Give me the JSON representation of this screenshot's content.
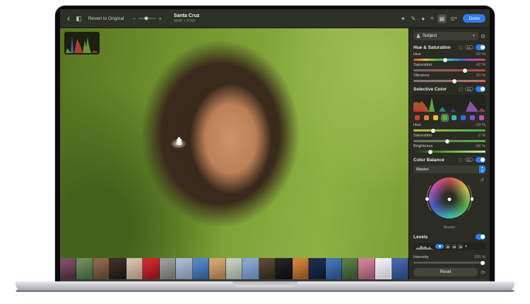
{
  "toolbar": {
    "back": "‹",
    "revert_label": "Revert to Original",
    "zoom_out": "−",
    "zoom_in": "+",
    "title": "Santa Cruz",
    "subtitle": "8640 × 5760",
    "done_label": "Done"
  },
  "sidebar": {
    "preset_label": "Subject",
    "hue_saturation": {
      "title": "Hue & Saturation",
      "ml": "ML",
      "sliders": [
        {
          "label": "Hue",
          "value": "-10 %",
          "pos": "44%"
        },
        {
          "label": "Saturation",
          "value": "42 %",
          "pos": "72%"
        },
        {
          "label": "Vibrance",
          "value": "20 %",
          "pos": "57%"
        }
      ]
    },
    "selective_color": {
      "title": "Selective Color",
      "ml": "ML",
      "swatches": [
        "#d23f33",
        "#e07f2e",
        "#e6c02e",
        "#4fb43a",
        "#35b8ae",
        "#3a6ae0",
        "#7f4fd0",
        "#c04fae"
      ],
      "selected_swatch_index": 3,
      "sliders": [
        {
          "label": "Hue",
          "value": "-18 %",
          "pos": "27%"
        },
        {
          "label": "Saturation",
          "value": "-3 %",
          "pos": "47%"
        },
        {
          "label": "Brightness",
          "value": "-46 %",
          "pos": "24%"
        }
      ]
    },
    "color_balance": {
      "title": "Color Balance",
      "ml": "ML",
      "range_label": "Master",
      "wheel_label": "Master"
    },
    "levels": {
      "title": "Levels"
    },
    "intensity": {
      "label": "Intensity",
      "value": "100 %",
      "pos": "96%"
    },
    "reset_label": "Reset"
  },
  "filmstrip": {
    "selected_index": 19,
    "thumbs": [
      {
        "c1": "#7a4e62",
        "c2": "#4a2c3a"
      },
      {
        "c1": "#6d8a58",
        "c2": "#44603a"
      },
      {
        "c1": "#8a6648",
        "c2": "#5c4230"
      },
      {
        "c1": "#3a2e26",
        "c2": "#1e1814"
      },
      {
        "c1": "#d0bcac",
        "c2": "#a88e7c"
      },
      {
        "c1": "#cc2830",
        "c2": "#8e1418"
      },
      {
        "c1": "#9a9a9a",
        "c2": "#6e6e6e"
      },
      {
        "c1": "#aab8cc",
        "c2": "#7e8ca6"
      },
      {
        "c1": "#5484c0",
        "c2": "#2e5a92"
      },
      {
        "c1": "#d0a470",
        "c2": "#9a744a"
      },
      {
        "c1": "#c2ccc2",
        "c2": "#92a096"
      },
      {
        "c1": "#8aa8cc",
        "c2": "#5e80ac"
      },
      {
        "c1": "#584630",
        "c2": "#32281a"
      },
      {
        "c1": "#222226",
        "c2": "#0e0e12"
      },
      {
        "c1": "#cc8238",
        "c2": "#8e5420"
      },
      {
        "c1": "#1e2c4c",
        "c2": "#101a32"
      },
      {
        "c1": "#4274b0",
        "c2": "#264e80"
      },
      {
        "c1": "#567a44",
        "c2": "#35502a"
      },
      {
        "c1": "#cc8096",
        "c2": "#945668"
      },
      {
        "c1": "#ececee",
        "c2": "#c2c2c6"
      },
      {
        "c1": "#4466a6",
        "c2": "#2a4478"
      }
    ]
  }
}
